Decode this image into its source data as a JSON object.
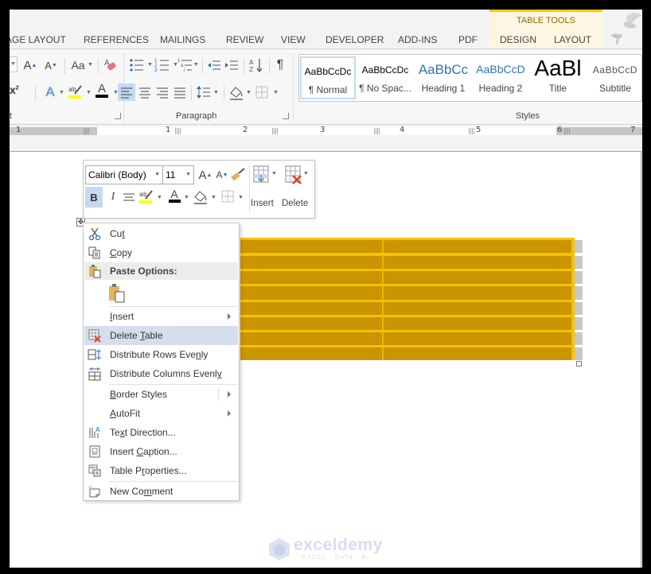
{
  "ribbon_tabs": {
    "page_layout": "AGE LAYOUT",
    "references": "REFERENCES",
    "mailings": "MAILINGS",
    "review": "REVIEW",
    "view": "VIEW",
    "developer": "DEVELOPER",
    "add_ins": "ADD-INS",
    "pdf": "PDF",
    "design": "DESIGN",
    "layout": "LAYOUT",
    "contextual_group": "TABLE TOOLS"
  },
  "ribbon": {
    "font_group_label": "t",
    "paragraph_group_label": "Paragraph",
    "styles_group_label": "Styles",
    "change_case_label": "Aa",
    "pilcrow": "¶",
    "styles": [
      {
        "sample": "AaBbCcDc",
        "name": "¶ Normal",
        "selected": true
      },
      {
        "sample": "AaBbCcDc",
        "name": "¶ No Spac...",
        "selected": false
      },
      {
        "sample": "AaBbCc",
        "name": "Heading 1",
        "selected": false
      },
      {
        "sample": "AaBbCcD",
        "name": "Heading 2",
        "selected": false
      },
      {
        "sample": "AaBl",
        "name": "Title",
        "selected": false
      },
      {
        "sample": "AaBbCcD",
        "name": "Subtitle",
        "selected": false
      }
    ]
  },
  "ruler": {
    "numbers": [
      "1",
      "1",
      "2",
      "3",
      "4",
      "5",
      "6",
      "7"
    ]
  },
  "mini_toolbar": {
    "font_name": "Calibri (Body)",
    "font_size": "11",
    "bold_label": "B",
    "italic_label": "I",
    "insert_label": "Insert",
    "delete_label": "Delete"
  },
  "context_menu": {
    "items": [
      {
        "label_parts": [
          "Cu",
          "t",
          ""
        ],
        "name": "cut"
      },
      {
        "label_parts": [
          "",
          "C",
          "opy"
        ],
        "name": "copy"
      },
      {
        "label": "Paste Options:",
        "name": "paste-options"
      },
      {
        "label_parts": [
          "",
          "I",
          "nsert"
        ],
        "name": "insert",
        "submenu": true
      },
      {
        "label_parts": [
          "Delete ",
          "T",
          "able"
        ],
        "name": "delete-table",
        "highlighted": true
      },
      {
        "label_parts": [
          "Distribute Rows Eve",
          "n",
          "ly"
        ],
        "name": "distribute-rows"
      },
      {
        "label_parts": [
          "Distribute Columns Evenl",
          "y",
          ""
        ],
        "name": "distribute-columns"
      },
      {
        "label_parts": [
          "",
          "B",
          "order Styles"
        ],
        "name": "border-styles",
        "submenu": true
      },
      {
        "label_parts": [
          "",
          "A",
          "utoFit"
        ],
        "name": "autofit",
        "submenu": true
      },
      {
        "label_parts": [
          "Te",
          "x",
          "t Direction..."
        ],
        "name": "text-direction"
      },
      {
        "label_parts": [
          "Insert ",
          "C",
          "aption..."
        ],
        "name": "insert-caption"
      },
      {
        "label_parts": [
          "Table P",
          "r",
          "operties..."
        ],
        "name": "table-properties"
      },
      {
        "label_parts": [
          "New Co",
          "m",
          "ment"
        ],
        "name": "new-comment"
      }
    ]
  },
  "table": {
    "rows": 8,
    "columns": 2,
    "fill_color": "#c99500",
    "border_color": "#f7c100"
  },
  "watermark": {
    "title": "exceldemy",
    "subtitle": "EXCEL · DATA · BI"
  }
}
